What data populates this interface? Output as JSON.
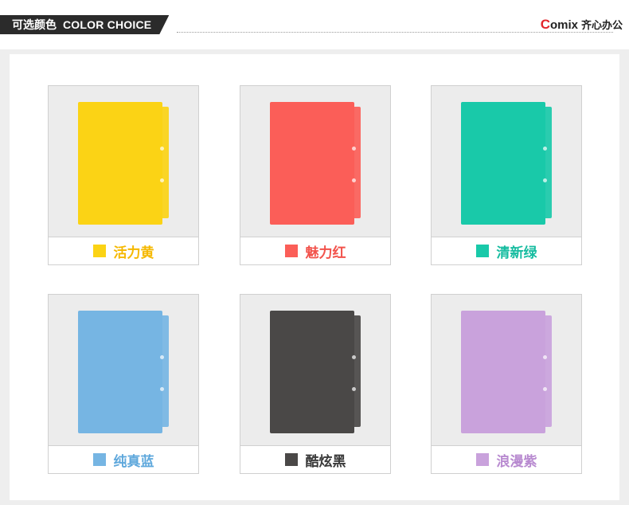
{
  "header": {
    "title_cn": "可选颜色",
    "title_en": "COLOR CHOICE",
    "brand_logo_first": "C",
    "brand_logo_rest": "omix",
    "brand_cn": "齐心办公"
  },
  "colors": [
    {
      "name": "活力黄",
      "hex": "#fbd315",
      "label_color": "#f5b800"
    },
    {
      "name": "魅力红",
      "hex": "#fb5e58",
      "label_color": "#f2524b"
    },
    {
      "name": "清新绿",
      "hex": "#19c9a9",
      "label_color": "#16bca0"
    },
    {
      "name": "纯真蓝",
      "hex": "#76b5e3",
      "label_color": "#5fa8dc"
    },
    {
      "name": "酷炫黑",
      "hex": "#4a4847",
      "label_color": "#3a3a3a"
    },
    {
      "name": "浪漫紫",
      "hex": "#c9a2dc",
      "label_color": "#b88ad0"
    }
  ]
}
